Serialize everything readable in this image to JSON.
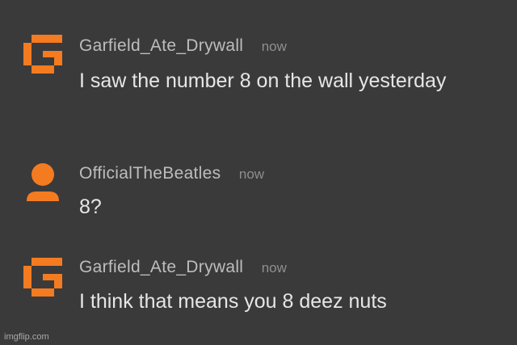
{
  "colors": {
    "background": "#3a3a3a",
    "accent": "#f47b20",
    "username": "#bdbdbd",
    "timestamp": "#8f8f8f",
    "text": "#e6e6e6"
  },
  "comments": [
    {
      "avatar_icon": "imgflip-g-logo-icon",
      "username": "Garfield_Ate_Drywall",
      "time": "now",
      "text": "I saw the number 8 on the wall yesterday"
    },
    {
      "avatar_icon": "default-user-avatar-icon",
      "username": "OfficialTheBeatles",
      "time": "now",
      "text": "8?"
    },
    {
      "avatar_icon": "imgflip-g-logo-icon",
      "username": "Garfield_Ate_Drywall",
      "time": "now",
      "text": "I think that means you 8 deez nuts"
    }
  ],
  "watermark": "imgflip.com"
}
